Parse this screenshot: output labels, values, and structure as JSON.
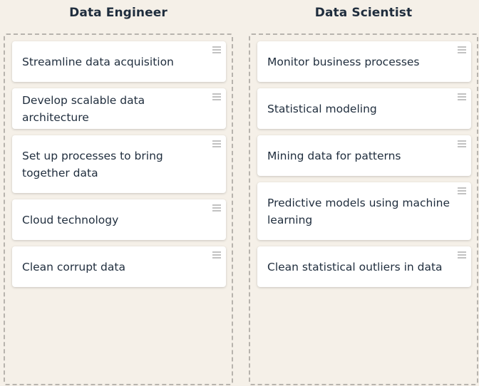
{
  "columns": [
    {
      "title": "Data Engineer",
      "cards": [
        "Streamline data acquisition",
        "Develop scalable data architecture",
        "Set up processes to bring together data",
        "Cloud technology",
        "Clean corrupt data"
      ]
    },
    {
      "title": "Data Scientist",
      "cards": [
        "Monitor business processes",
        "Statistical modeling",
        "Mining data for patterns",
        "Predictive models using machine learning",
        "Clean statistical outliers in data"
      ]
    }
  ],
  "icons": {
    "card_handle": "drag-handle-icon"
  }
}
